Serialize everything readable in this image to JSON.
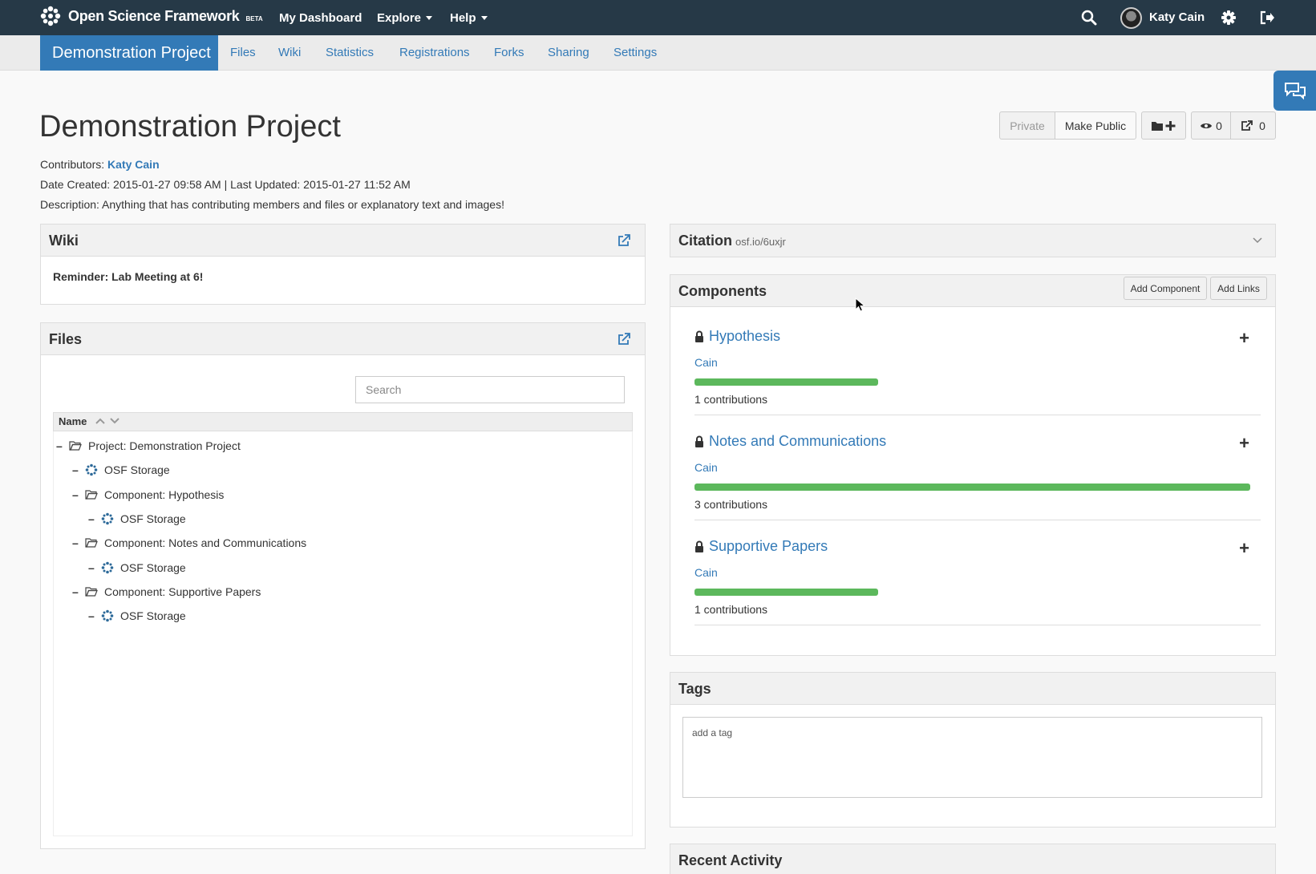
{
  "topbar": {
    "brand_name": "Open Science Framework",
    "brand_badge": "BETA",
    "nav_dashboard": "My Dashboard",
    "nav_explore": "Explore",
    "nav_help": "Help",
    "user_name": "Katy Cain",
    "icons": [
      "osf-logo-icon",
      "search-icon",
      "avatar",
      "gear-icon",
      "logout-icon"
    ]
  },
  "subnav": {
    "active": "Demonstration Project",
    "links": [
      "Files",
      "Wiki",
      "Statistics",
      "Registrations",
      "Forks",
      "Sharing",
      "Settings"
    ]
  },
  "project": {
    "title": "Demonstration Project",
    "contributors_label": "Contributors:",
    "contributor": "Katy Cain",
    "dates": "Date Created: 2015-01-27 09:58 AM | Last Updated: 2015-01-27 11:52 AM",
    "description": "Description: Anything that has contributing members and files or explanatory text and images!"
  },
  "actions": {
    "private": "Private",
    "make_public": "Make Public",
    "watch_count": "0",
    "fork_count": "0"
  },
  "wiki": {
    "title": "Wiki",
    "content": "Reminder: Lab Meeting at 6!"
  },
  "files": {
    "title": "Files",
    "search_placeholder": "Search",
    "column_name": "Name",
    "tree": [
      {
        "label": "Project: Demonstration Project",
        "icon": "folder-open-icon"
      },
      {
        "label": "OSF Storage",
        "icon": "osf-storage-icon"
      },
      {
        "label": "Component: Hypothesis",
        "icon": "folder-open-icon"
      },
      {
        "label": "OSF Storage",
        "icon": "osf-storage-icon"
      },
      {
        "label": "Component: Notes and Communications",
        "icon": "folder-open-icon"
      },
      {
        "label": "OSF Storage",
        "icon": "osf-storage-icon"
      },
      {
        "label": "Component: Supportive Papers",
        "icon": "folder-open-icon"
      },
      {
        "label": "OSF Storage",
        "icon": "osf-storage-icon"
      }
    ]
  },
  "citation": {
    "title": "Citation",
    "link": "osf.io/6uxjr"
  },
  "components": {
    "title": "Components",
    "add_component": "Add Component",
    "add_links": "Add Links",
    "items": [
      {
        "name": "Hypothesis",
        "contributor": "Cain",
        "contributions": "1 contributions",
        "progress": 0.33
      },
      {
        "name": "Notes and Communications",
        "contributor": "Cain",
        "contributions": "3 contributions",
        "progress": 1.0
      },
      {
        "name": "Supportive Papers",
        "contributor": "Cain",
        "contributions": "1 contributions",
        "progress": 0.33
      }
    ]
  },
  "tags": {
    "title": "Tags",
    "placeholder": "add a tag"
  },
  "recent_activity": {
    "title": "Recent Activity"
  },
  "colors": {
    "navbar": "#263947",
    "primary": "#337ab7",
    "progress": "#5cb85c"
  }
}
